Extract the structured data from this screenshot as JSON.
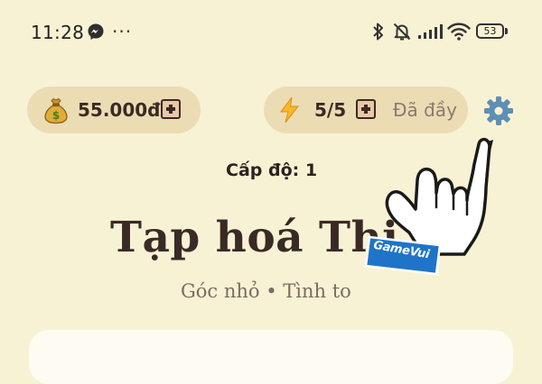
{
  "status_bar": {
    "time": "11:28",
    "more": "···",
    "battery": "53",
    "icons": [
      "messenger-icon",
      "bluetooth-icon",
      "bell-muted-icon",
      "signal-icon",
      "wifi-icon",
      "battery-icon"
    ]
  },
  "coins": {
    "icon": "money-bag-icon",
    "value": "55.000đ"
  },
  "energy": {
    "icon": "lightning-icon",
    "value": "5/5",
    "status": "Đã đầy"
  },
  "settings": {
    "icon": "gear-icon"
  },
  "level": {
    "label": "Cấp độ: 1"
  },
  "shop": {
    "title": "Tạp hoá Thị",
    "subtitle": "Góc nhỏ • Tình to"
  },
  "overlay": {
    "icon": "pointing-hand-icon",
    "watermark": "GameVui"
  },
  "colors": {
    "background": "#f8f2d5",
    "pill": "#ecdcb4",
    "text": "#3a2a25",
    "muted": "#8a7a6e",
    "gear": "#5e8fb5",
    "watermark": "#1f74c8"
  }
}
